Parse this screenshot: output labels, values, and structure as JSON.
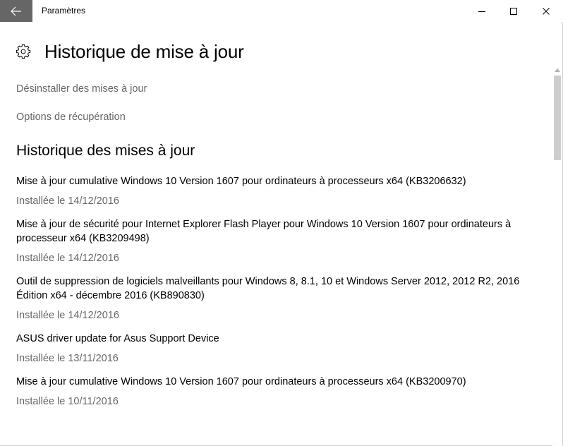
{
  "window": {
    "app_title": "Paramètres"
  },
  "header": {
    "title": "Historique de mise à jour"
  },
  "links": {
    "uninstall": "Désinstaller des mises à jour",
    "recovery": "Options de récupération"
  },
  "section": {
    "title": "Historique des mises à jour"
  },
  "updates": [
    {
      "name": "Mise à jour cumulative Windows 10 Version 1607 pour ordinateurs à processeurs x64 (KB3206632)",
      "status": "Installée le 14/12/2016"
    },
    {
      "name": "Mise à jour de sécurité pour Internet Explorer Flash Player pour Windows 10 Version 1607 pour ordinateurs à processeur x64 (KB3209498)",
      "status": "Installée le 14/12/2016"
    },
    {
      "name": "Outil de suppression de logiciels malveillants pour Windows 8, 8.1, 10 et Windows Server 2012, 2012 R2, 2016 Édition x64 - décembre 2016 (KB890830)",
      "status": "Installée le 14/12/2016"
    },
    {
      "name": "ASUS driver update for Asus Support Device",
      "status": "Installée le 13/11/2016"
    },
    {
      "name": "Mise à jour cumulative Windows 10 Version 1607 pour ordinateurs à processeurs x64 (KB3200970)",
      "status": "Installée le 10/11/2016"
    }
  ],
  "colors": {
    "back_button_bg": "#666666",
    "secondary_text": "#666666",
    "primary_text": "#000000",
    "scroll_thumb": "#cdcdcd"
  },
  "icons": {
    "back": "back-arrow-icon",
    "minimize": "minimize-icon",
    "maximize": "maximize-icon",
    "close": "close-icon",
    "settings": "gear-icon"
  }
}
